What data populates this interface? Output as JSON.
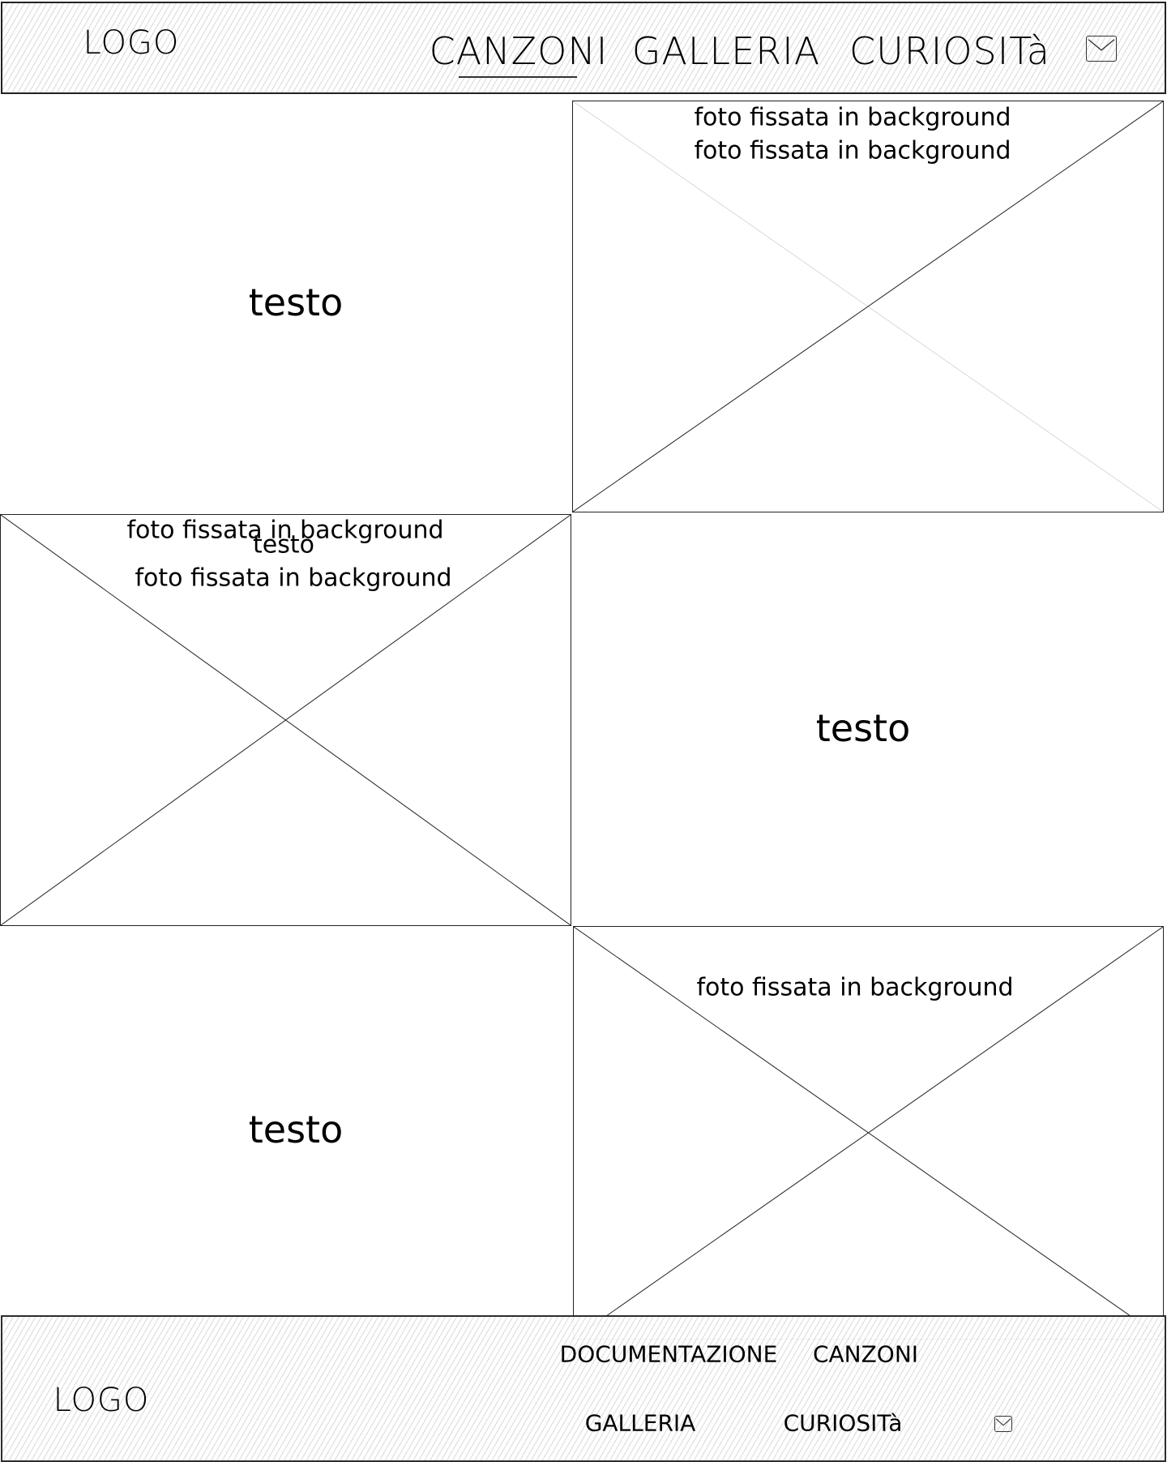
{
  "header": {
    "logo": "LOGO",
    "nav": [
      {
        "label": "CANZONI",
        "active": true
      },
      {
        "label": "GALLERIA"
      },
      {
        "label": "CURIOSITà"
      }
    ],
    "mail_icon": "envelope-icon"
  },
  "sections": [
    {
      "text": "testo",
      "image_captions": [
        "foto fissata in background",
        "foto fissata in background"
      ]
    },
    {
      "text": "testo",
      "image_captions": [
        "foto fissata in background",
        "testo",
        "foto fissata in background"
      ]
    },
    {
      "text": "testo",
      "image_captions": [
        "foto fissata in background"
      ]
    }
  ],
  "footer": {
    "logo": "LOGO",
    "nav": [
      "DOCUMENTAZIONE",
      "CANZONI",
      "GALLERIA",
      "CURIOSITà"
    ],
    "mail_icon": "envelope-icon"
  }
}
